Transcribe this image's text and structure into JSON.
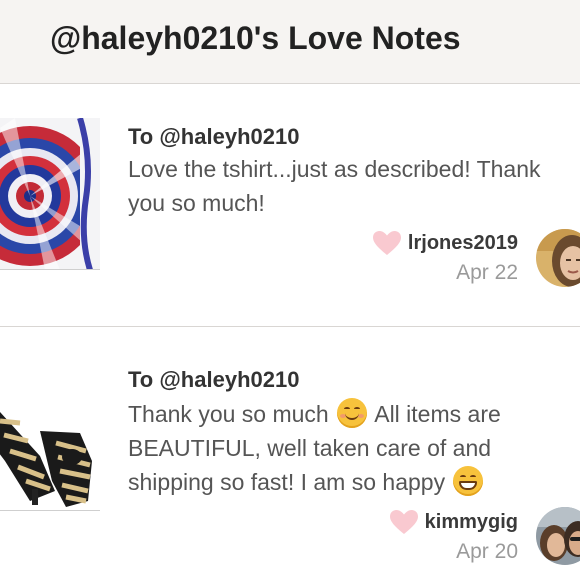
{
  "header": {
    "title": "@haleyh0210's Love Notes"
  },
  "notes": [
    {
      "to": "To @haleyh0210",
      "lines": [
        "Love the tshirt...just as described! Thank",
        "you so much!"
      ],
      "username": "lrjones2019",
      "date": "Apr 22",
      "thumbnail": "tie-dye-tshirt-photo",
      "avatar": "user-photo"
    },
    {
      "to": "To @haleyh0210",
      "line1_a": "Thank you so much",
      "line1_b": "All items are",
      "line2": "BEAUTIFUL, well taken care of and",
      "line3": "shipping so fast! I am so happy",
      "emoji1": "smiling-face-emoji",
      "emoji2": "grinning-face-emoji",
      "username": "kimmygig",
      "date": "Apr 20",
      "thumbnail": "zebra-sandals-photo",
      "avatar": "user-photo"
    }
  ],
  "colors": {
    "header_bg": "#f6f4f2",
    "heart": "#f9c9d0",
    "text": "#555555",
    "muted": "#9a9a9a"
  }
}
